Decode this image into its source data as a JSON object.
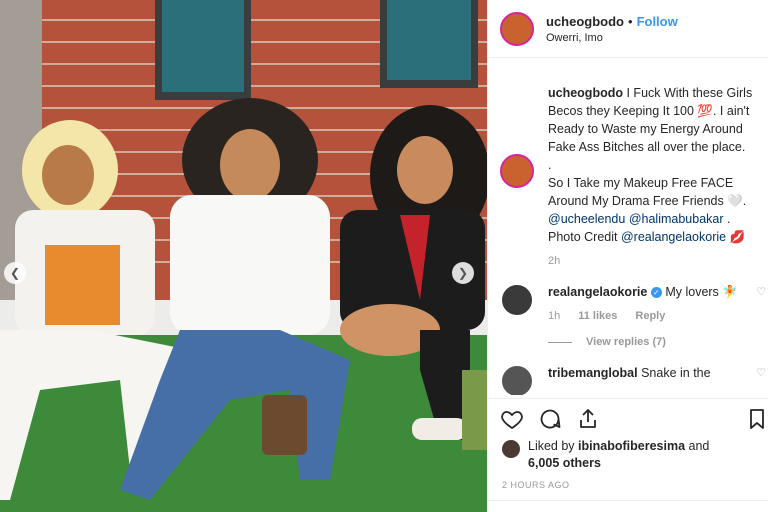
{
  "header": {
    "username": "ucheogbodo",
    "dot": "•",
    "follow_label": "Follow",
    "location": "Owerri, Imo"
  },
  "caption": {
    "username": "ucheogbodo",
    "text_1": "I Fuck With these Girls Becos they Keeping It 100 💯. I ain't Ready to Waste my Energy Around Fake Ass Bitches all over the place.",
    "text_2": ".",
    "text_3": "So I Take my Makeup Free FACE Around My Drama Free Friends 🤍.",
    "mention_1": "@ucheelendu",
    "mention_2": "@halimabubakar",
    "text_4": ".",
    "credit_prefix": "Photo Credit",
    "mention_3": "@realangelaokorie",
    "credit_suffix": "💋",
    "time": "2h"
  },
  "comments": [
    {
      "username": "realangelaokorie",
      "verified_icon": "verified-badge-icon",
      "text": "My lovers 🧚",
      "time": "1h",
      "likes": "11 likes",
      "reply_label": "Reply",
      "view_replies": "View replies (7)"
    },
    {
      "username": "tribemanglobal",
      "text": "Snake in the"
    }
  ],
  "actions": {
    "like_icon": "heart-icon",
    "comment_icon": "comment-icon",
    "share_icon": "share-icon",
    "save_icon": "bookmark-icon"
  },
  "likes": {
    "prefix": "Liked by",
    "user": "ibinabofiberesima",
    "and": "and",
    "count": "6,005 others"
  },
  "timestamp": "2 HOURS AGO",
  "colors": {
    "accent": "#3897f0",
    "ring": "#d6249f",
    "brick": "#b5523b",
    "grass": "#3d8a3a"
  }
}
